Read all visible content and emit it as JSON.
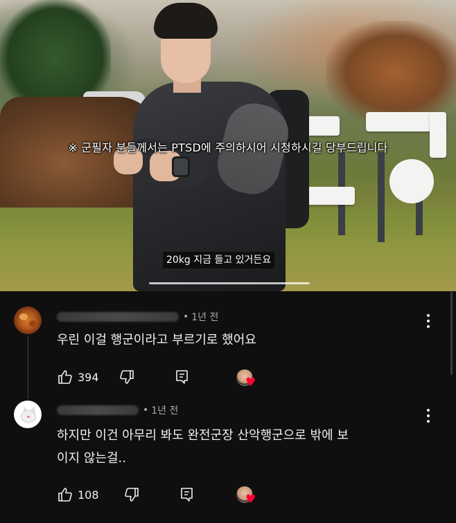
{
  "video": {
    "notice": "※ 군필자 분들께서는 PTSD에 주의하시어 시청하시길 당부드립니다",
    "caption": "20kg 지금 들고 있거든요"
  },
  "comments": [
    {
      "author": "●●●●●●●●●●●●",
      "avatar_icon": "fried-chicken-avatar",
      "time": "1년 전",
      "text_lines": [
        "우린 이걸 행군이라고 부르기로 했어요"
      ],
      "likes": "394",
      "creator_heart": true
    },
    {
      "author": "●●●●●●●●●●",
      "avatar_icon": "white-cat-avatar",
      "time": "1년 전",
      "text_lines": [
        "하지만 이건 아무리 봐도 완전군장 산악행군으로 밖에 보",
        "이지 않는걸.."
      ],
      "likes": "108",
      "creator_heart": true
    }
  ],
  "colors": {
    "background": "#0f0f0f",
    "text": "#f1f1f1",
    "meta_text": "#aaaaaa",
    "heart": "#ff0033"
  }
}
